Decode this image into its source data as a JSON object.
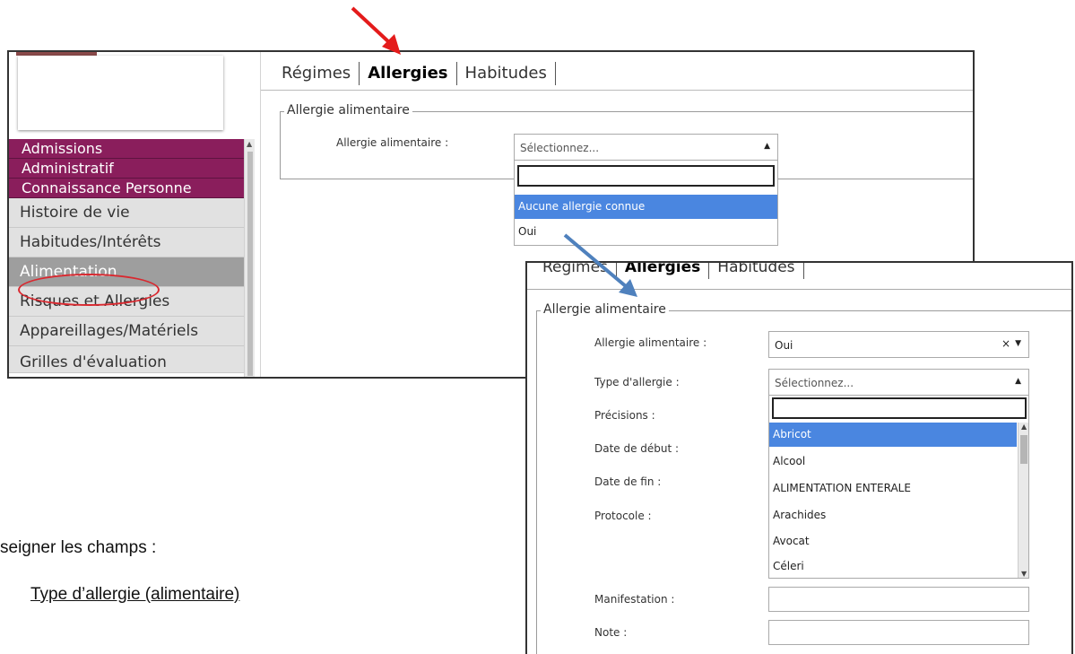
{
  "screenshot1": {
    "sidebar": {
      "sections": [
        "Admissions",
        "Administratif",
        "Connaissance Personne"
      ],
      "items": [
        "Histoire de vie",
        "Habitudes/Intérêts",
        "Alimentation",
        "Risques et Allergies",
        "Appareillages/Matériels",
        "Grilles d'évaluation"
      ],
      "active_item": "Alimentation"
    },
    "tabs": [
      "Régimes",
      "Allergies",
      "Habitudes"
    ],
    "active_tab": "Allergies",
    "fieldset_legend": "Allergie alimentaire",
    "field_label": "Allergie alimentaire :",
    "select_placeholder": "Sélectionnez...",
    "options": [
      "Aucune allergie connue",
      "Oui"
    ],
    "highlighted_option": "Aucune allergie connue"
  },
  "screenshot2": {
    "tabs": [
      "Régimes",
      "Allergies",
      "Habitudes"
    ],
    "active_tab": "Allergies",
    "fieldset_legend": "Allergie alimentaire",
    "labels": {
      "allergie": "Allergie alimentaire :",
      "type": "Type d'allergie :",
      "precisions": "Précisions :",
      "debut": "Date de début :",
      "fin": "Date de fin :",
      "protocole": "Protocole :",
      "manifestation": "Manifestation :",
      "note": "Note :"
    },
    "allergie_value": "Oui",
    "clear_symbol": "×",
    "type_placeholder": "Sélectionnez...",
    "type_options": [
      "Abricot",
      "Alcool",
      "ALIMENTATION ENTERALE",
      "Arachides",
      "Avocat",
      "Céleri"
    ],
    "highlighted_option": "Abricot"
  },
  "instructions": {
    "line1": "seigner les champs :",
    "line2": "Type d’allergie (alimentaire)"
  },
  "colors": {
    "menu_purple": "#8a1e5c",
    "highlight_blue": "#4a86e0",
    "red_arrow": "#e41b1b",
    "blue_arrow": "#4f81bd"
  }
}
